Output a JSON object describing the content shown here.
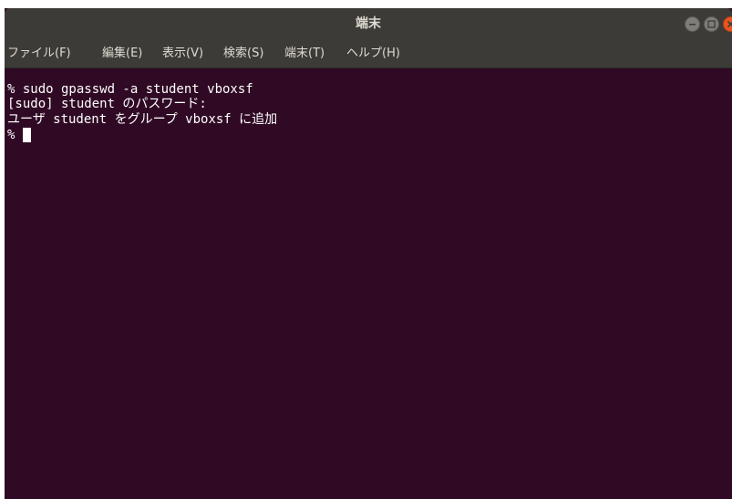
{
  "window": {
    "title": "端末"
  },
  "window_controls": {
    "minimize_icon": "minimize-icon",
    "maximize_icon": "maximize-icon",
    "close_icon": "close-icon",
    "close_color": "#e95420"
  },
  "menubar": {
    "items": [
      {
        "label": "ファイル(F)"
      },
      {
        "label": "編集(E)"
      },
      {
        "label": "表示(V)"
      },
      {
        "label": "検索(S)"
      },
      {
        "label": "端末(T)"
      },
      {
        "label": "ヘルプ(H)"
      }
    ]
  },
  "terminal": {
    "background": "#300a24",
    "lines": [
      "% sudo gpasswd -a student vboxsf",
      "[sudo] student のパスワード:",
      "ユーザ student をグループ vboxsf に追加"
    ],
    "prompt": "%"
  }
}
